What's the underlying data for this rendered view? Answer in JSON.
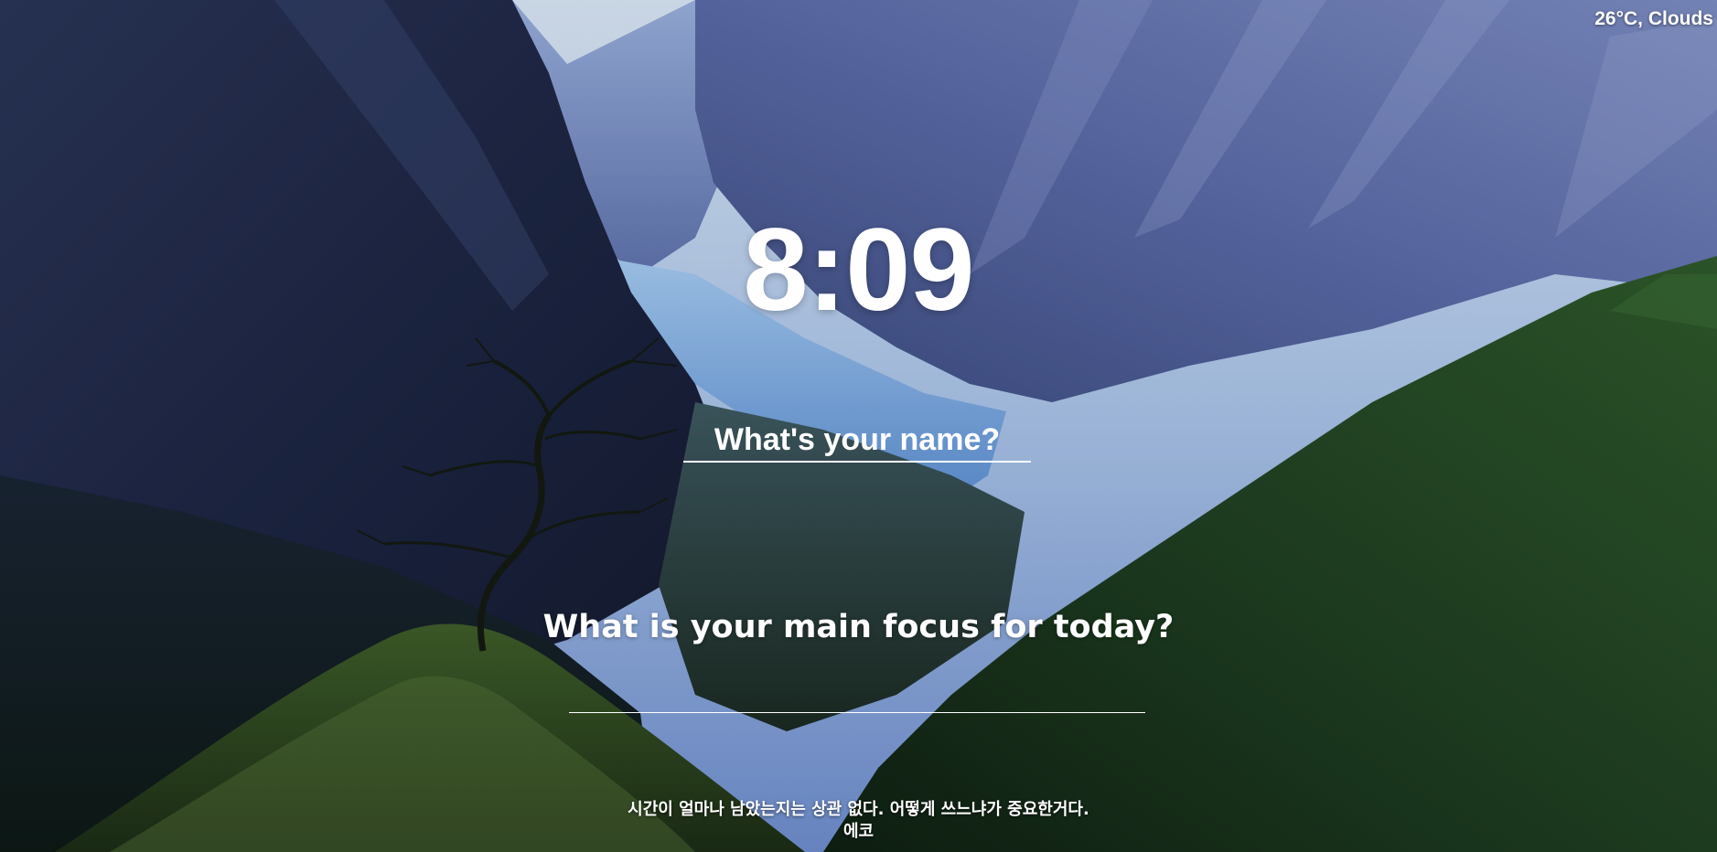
{
  "weather": {
    "text": "26°C, Clouds"
  },
  "clock": {
    "time": "8:09"
  },
  "name_form": {
    "placeholder": "What's your name?"
  },
  "focus": {
    "question": "What is your main focus for today?",
    "input_value": ""
  },
  "quote": {
    "text": "시간이 얼마나 남았는지는 상관 없다. 어떻게 쓰느냐가 중요한거다.",
    "author": "에코"
  },
  "colors": {
    "text": "#ffffff",
    "sky": "#bcd3ee",
    "forest": "#1f3a22"
  }
}
